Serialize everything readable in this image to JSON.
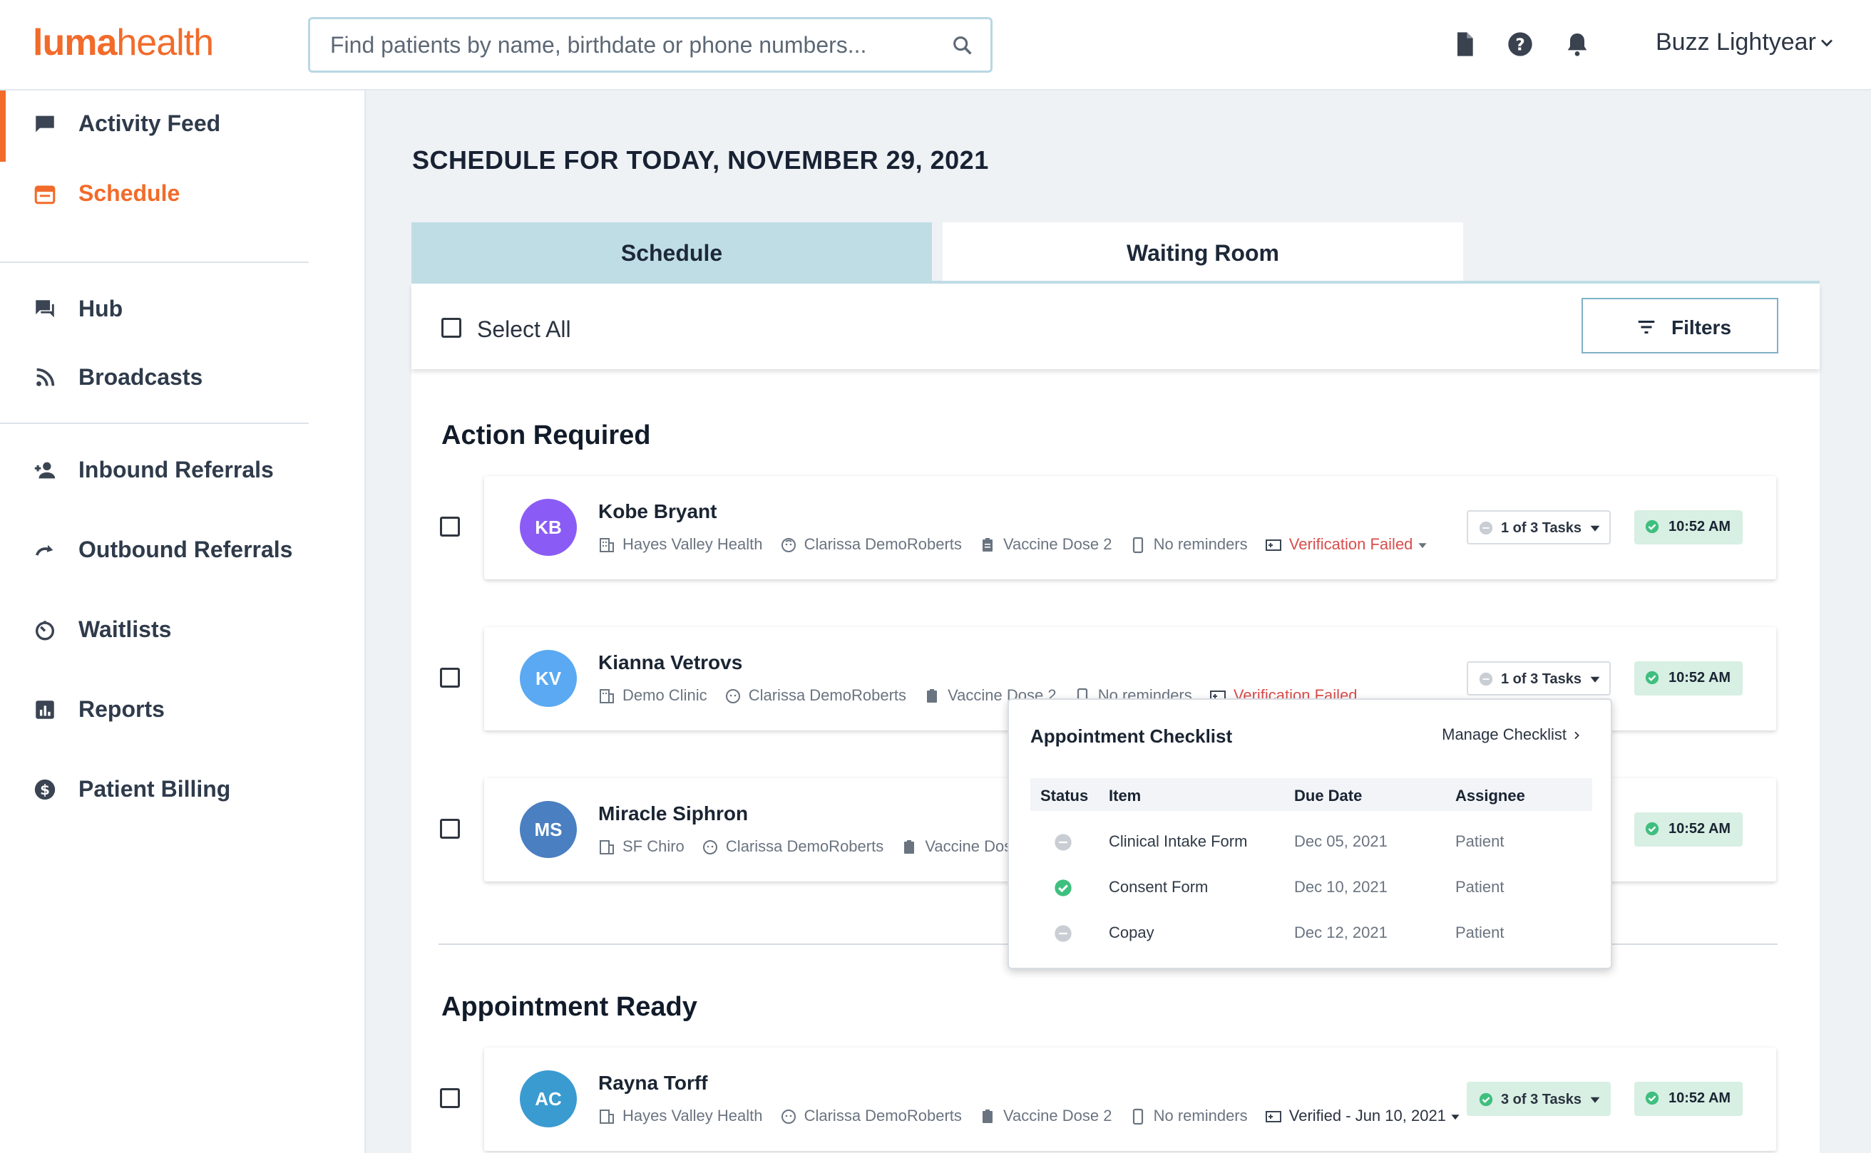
{
  "header": {
    "logo_part1": "luma",
    "logo_part2": "health",
    "search_placeholder": "Find patients by name, birthdate or phone numbers...",
    "user_name": "Buzz Lightyear"
  },
  "sidebar": {
    "items": [
      {
        "label": "Activity Feed",
        "icon": "chat-icon"
      },
      {
        "label": "Schedule",
        "icon": "calendar-icon"
      },
      {
        "label": "Hub",
        "icon": "forum-icon"
      },
      {
        "label": "Broadcasts",
        "icon": "rss-icon"
      },
      {
        "label": "Inbound Referrals",
        "icon": "person-add-icon"
      },
      {
        "label": "Outbound Referrals",
        "icon": "redo-icon"
      },
      {
        "label": "Waitlists",
        "icon": "timer-icon"
      },
      {
        "label": "Reports",
        "icon": "bar-chart-icon"
      },
      {
        "label": "Patient Billing",
        "icon": "dollar-icon"
      }
    ],
    "active": "Schedule"
  },
  "main": {
    "title": "SCHEDULE FOR TODAY, NOVEMBER 29, 2021",
    "tabs": [
      {
        "label": "Schedule",
        "active": true
      },
      {
        "label": "Waiting Room",
        "active": false
      }
    ],
    "select_all_label": "Select All",
    "filters_label": "Filters"
  },
  "sections": {
    "action_required": "Action Required",
    "appointment_ready": "Appointment Ready"
  },
  "appointments": [
    {
      "initials": "KB",
      "avatar_color": "#8a5cf5",
      "name": "Kobe Bryant",
      "facility": "Hayes Valley Health",
      "provider": "Clarissa DemoRoberts",
      "type": "Vaccine Dose 2",
      "reminders": "No reminders",
      "verification": "Verification Failed",
      "tasks": "1 of 3 Tasks",
      "time": "10:52 AM"
    },
    {
      "initials": "KV",
      "avatar_color": "#5aa9f2",
      "name": "Kianna Vetrovs",
      "facility": "Demo Clinic",
      "provider": "Clarissa DemoRoberts",
      "type": "Vaccine Dose 2",
      "reminders": "No reminders",
      "verification": "Verification Failed",
      "tasks": "1 of 3 Tasks",
      "time": "10:52 AM"
    },
    {
      "initials": "MS",
      "avatar_color": "#4a7fc1",
      "name": "Miracle Siphron",
      "facility": "SF Chiro",
      "provider": "Clarissa DemoRoberts",
      "type": "Vaccine Dose 2",
      "time": "10:52 AM"
    },
    {
      "initials": "AC",
      "avatar_color": "#3a9bd0",
      "name": "Rayna Torff",
      "facility": "Hayes Valley Health",
      "provider": "Clarissa DemoRoberts",
      "type": "Vaccine Dose 2",
      "reminders": "No reminders",
      "verification": "Verified - Jun 10, 2021",
      "tasks": "3 of 3 Tasks",
      "time": "10:52 AM"
    }
  ],
  "checklist": {
    "title": "Appointment Checklist",
    "manage_label": "Manage Checklist",
    "columns": [
      "Status",
      "Item",
      "Due Date",
      "Assignee"
    ],
    "rows": [
      {
        "status": "pending",
        "item": "Clinical Intake Form",
        "due": "Dec 05, 2021",
        "assignee": "Patient"
      },
      {
        "status": "done",
        "item": "Consent Form",
        "due": "Dec 10, 2021",
        "assignee": "Patient"
      },
      {
        "status": "pending",
        "item": "Copay",
        "due": "Dec 12, 2021",
        "assignee": "Patient"
      }
    ]
  },
  "colors": {
    "brand": "#f26b2a",
    "tab_active": "#bfdde5",
    "success": "#3fbf7f",
    "error": "#d94c4c"
  }
}
